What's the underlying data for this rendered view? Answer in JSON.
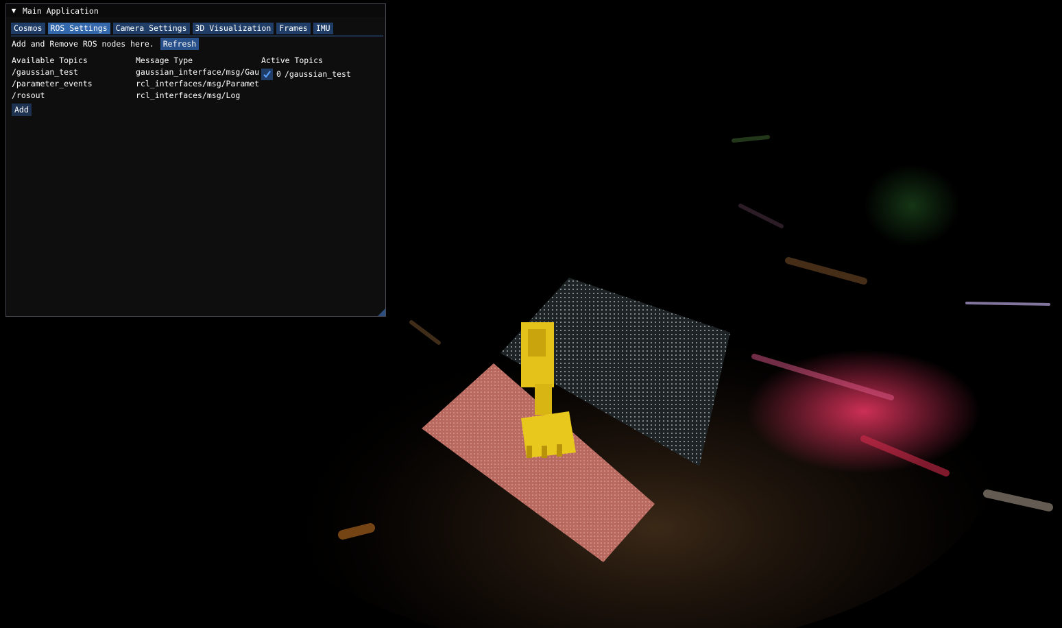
{
  "window": {
    "title": "Main Application",
    "collapse_icon": "triangle-down-icon"
  },
  "tabs": [
    {
      "label": "Cosmos",
      "active": false
    },
    {
      "label": "ROS Settings",
      "active": true
    },
    {
      "label": "Camera Settings",
      "active": false
    },
    {
      "label": "3D Visualization",
      "active": false
    },
    {
      "label": "Frames",
      "active": false
    },
    {
      "label": "IMU",
      "active": false
    }
  ],
  "ros": {
    "intro_text": "Add and Remove ROS nodes here.",
    "refresh_label": "Refresh",
    "available_header": "Available Topics",
    "type_header": "Message Type",
    "active_header": "Active Topics",
    "topics": [
      {
        "name": "/gaussian_test",
        "type": "gaussian_interface/msg/Gaussian"
      },
      {
        "name": "/parameter_events",
        "type": "rcl_interfaces/msg/ParameterEvent"
      },
      {
        "name": "/rosout",
        "type": "rcl_interfaces/msg/Log"
      }
    ],
    "active_topics": [
      {
        "checked": true,
        "index": "0",
        "name": "/gaussian_test"
      }
    ],
    "add_label": "Add"
  },
  "colors": {
    "tab": "#1f3d66",
    "tab_active": "#3468ad",
    "window_bg": "#0f0f0f",
    "accent": "#3a6fb8"
  }
}
